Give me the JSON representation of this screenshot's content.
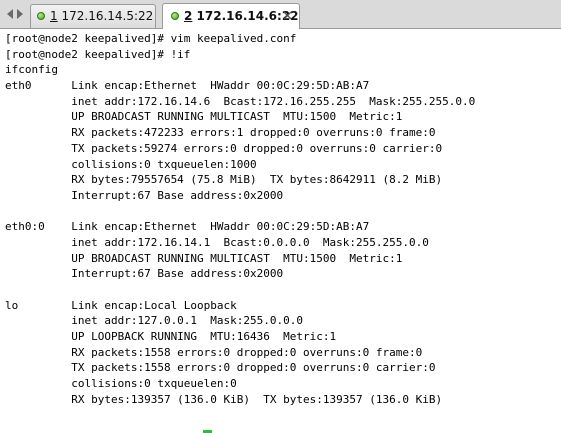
{
  "tabs": [
    {
      "index": "1",
      "title": "172.16.14.5:22",
      "active": false
    },
    {
      "index": "2",
      "title": "172.16.14.6:22",
      "active": true
    }
  ],
  "colors": {
    "status_dot": "#3fa21b",
    "cursor": "#22c43b",
    "terminal_bg": "#ffffff",
    "terminal_fg": "#000000"
  },
  "icons": {
    "nav_left": "triangle-left-icon",
    "nav_right": "triangle-right-icon",
    "tab_status": "connected-status-icon",
    "tab_close": "close-icon"
  },
  "terminal": {
    "lines": [
      "[root@node2 keepalived]# vim keepalived.conf",
      "[root@node2 keepalived]# !if",
      "ifconfig",
      "eth0      Link encap:Ethernet  HWaddr 00:0C:29:5D:AB:A7",
      "          inet addr:172.16.14.6  Bcast:172.16.255.255  Mask:255.255.0.0",
      "          UP BROADCAST RUNNING MULTICAST  MTU:1500  Metric:1",
      "          RX packets:472233 errors:1 dropped:0 overruns:0 frame:0",
      "          TX packets:59274 errors:0 dropped:0 overruns:0 carrier:0",
      "          collisions:0 txqueuelen:1000",
      "          RX bytes:79557654 (75.8 MiB)  TX bytes:8642911 (8.2 MiB)",
      "          Interrupt:67 Base address:0x2000",
      "",
      "eth0:0    Link encap:Ethernet  HWaddr 00:0C:29:5D:AB:A7",
      "          inet addr:172.16.14.1  Bcast:0.0.0.0  Mask:255.255.0.0",
      "          UP BROADCAST RUNNING MULTICAST  MTU:1500  Metric:1",
      "          Interrupt:67 Base address:0x2000",
      "",
      "lo        Link encap:Local Loopback",
      "          inet addr:127.0.0.1  Mask:255.0.0.0",
      "          UP LOOPBACK RUNNING  MTU:16436  Metric:1",
      "          RX packets:1558 errors:0 dropped:0 overruns:0 frame:0",
      "          TX packets:1558 errors:0 dropped:0 overruns:0 carrier:0",
      "          collisions:0 txqueuelen:0",
      "          RX bytes:139357 (136.0 KiB)  TX bytes:139357 (136.0 KiB)"
    ]
  }
}
